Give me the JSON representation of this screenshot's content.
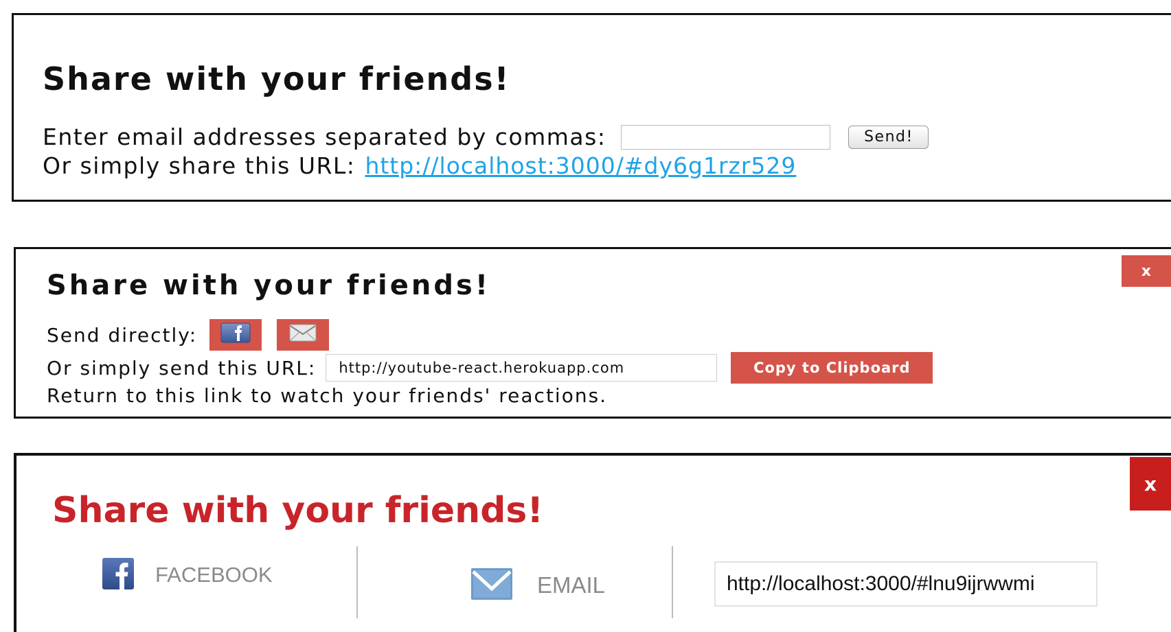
{
  "panel1": {
    "title": "Share with your friends!",
    "email_label": "Enter email addresses separated by commas:",
    "email_value": "",
    "send_label": "Send!",
    "url_label": "Or simply share this URL:",
    "url_link": "http://localhost:3000/#dy6g1rzr529"
  },
  "panel2": {
    "close_label": "x",
    "title": "Share with your friends!",
    "send_directly_label": "Send directly:",
    "url_label": "Or simply send this URL:",
    "url_value": "http://youtube-react.herokuapp.com",
    "copy_label": "Copy to Clipboard",
    "return_text": "Return to this link to watch your friends' reactions.",
    "icons": [
      "facebook-icon",
      "envelope-icon"
    ]
  },
  "panel3": {
    "close_label": "x",
    "title": "Share with your friends!",
    "facebook_label": "FACEBOOK",
    "email_label": "EMAIL",
    "url_value": "http://localhost:3000/#lnu9ijrwwmi",
    "icons": [
      "facebook-icon",
      "envelope-icon"
    ]
  },
  "colors": {
    "link": "#1ea3e6",
    "button_red": "#d4544a",
    "close_red": "#c81e1e",
    "title_red": "#c8242a",
    "facebook_blue": "#3b5998",
    "envelope_blue": "#6b9bc9"
  }
}
